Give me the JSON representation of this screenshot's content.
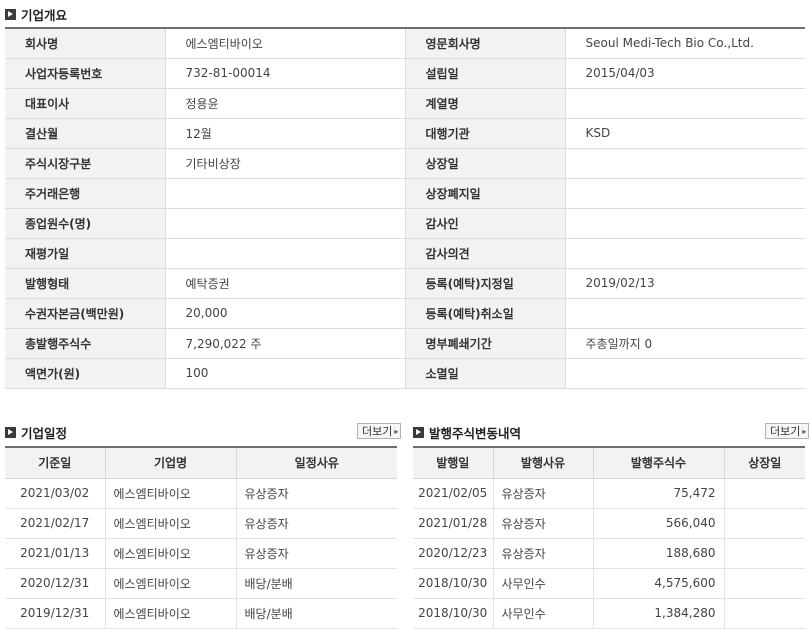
{
  "overview": {
    "title": "기업개요",
    "rows": [
      {
        "l1": "회사명",
        "v1": "에스엠티바이오",
        "l2": "영문회사명",
        "v2": "Seoul Medi-Tech Bio Co.,Ltd."
      },
      {
        "l1": "사업자등록번호",
        "v1": "732-81-00014",
        "l2": "설립일",
        "v2": "2015/04/03"
      },
      {
        "l1": "대표이사",
        "v1": "정용윤",
        "l2": "계열명",
        "v2": ""
      },
      {
        "l1": "결산월",
        "v1": "12월",
        "l2": "대행기관",
        "v2": "KSD"
      },
      {
        "l1": "주식시장구분",
        "v1": "기타비상장",
        "l2": "상장일",
        "v2": ""
      },
      {
        "l1": "주거래은행",
        "v1": "",
        "l2": "상장폐지일",
        "v2": ""
      },
      {
        "l1": "종업원수(명)",
        "v1": "",
        "l2": "감사인",
        "v2": ""
      },
      {
        "l1": "재평가일",
        "v1": "",
        "l2": "감사의견",
        "v2": ""
      },
      {
        "l1": "발행형태",
        "v1": "예탁증권",
        "l2": "등록(예탁)지정일",
        "v2": "2019/02/13"
      },
      {
        "l1": "수권자본금(백만원)",
        "v1": "20,000",
        "l2": "등록(예탁)취소일",
        "v2": ""
      },
      {
        "l1": "총발행주식수",
        "v1": "7,290,022 주",
        "l2": "명부폐쇄기간",
        "v2": "주총일까지 0"
      },
      {
        "l1": "액면가(원)",
        "v1": "100",
        "l2": "소멸일",
        "v2": ""
      }
    ]
  },
  "schedule": {
    "title": "기업일정",
    "more_label": "더보기",
    "headers": [
      "기준일",
      "기업명",
      "일정사유"
    ],
    "rows": [
      [
        "2021/03/02",
        "에스엠티바이오",
        "유상증자"
      ],
      [
        "2021/02/17",
        "에스엠티바이오",
        "유상증자"
      ],
      [
        "2021/01/13",
        "에스엠티바이오",
        "유상증자"
      ],
      [
        "2020/12/31",
        "에스엠티바이오",
        "배당/분배"
      ],
      [
        "2019/12/31",
        "에스엠티바이오",
        "배당/분배"
      ]
    ]
  },
  "issue": {
    "title": "발행주식변동내역",
    "more_label": "더보기",
    "headers": [
      "발행일",
      "발행사유",
      "발행주식수",
      "상장일"
    ],
    "rows": [
      [
        "2021/02/05",
        "유상증자",
        "75,472",
        ""
      ],
      [
        "2021/01/28",
        "유상증자",
        "566,040",
        ""
      ],
      [
        "2020/12/23",
        "유상증자",
        "188,680",
        ""
      ],
      [
        "2018/10/30",
        "사무인수",
        "4,575,600",
        ""
      ],
      [
        "2018/10/30",
        "사무인수",
        "1,384,280",
        ""
      ]
    ]
  }
}
